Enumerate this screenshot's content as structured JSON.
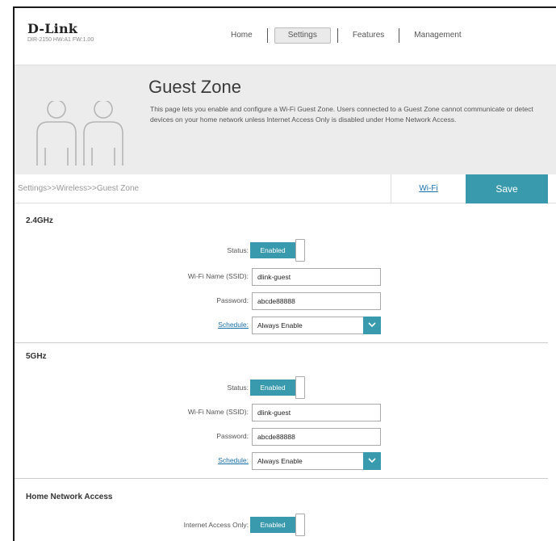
{
  "brand": {
    "logo": "D-Link",
    "model": "DIR-2150 HW:A1 FW:1.00"
  },
  "nav": {
    "home": "Home",
    "settings": "Settings",
    "features": "Features",
    "management": "Management"
  },
  "hero": {
    "title": "Guest Zone",
    "description": "This page lets you enable and configure a Wi-Fi Guest Zone. Users connected to a Guest Zone cannot communicate or detect devices on your home network unless Internet Access Only is disabled under Home Network Access.",
    "icon": "users-icon"
  },
  "breadcrumb": "Settings>>Wireless>>Guest Zone",
  "actions": {
    "wifi_link": "Wi-Fi",
    "save": "Save"
  },
  "band24": {
    "title": "2.4GHz",
    "status_label": "Status:",
    "status_value": "Enabled",
    "ssid_label": "Wi-Fi Name (SSID):",
    "ssid_value": "dlink-guest",
    "password_label": "Password:",
    "password_value": "abcde88888",
    "schedule_label": "Schedule:",
    "schedule_value": "Always Enable"
  },
  "band5": {
    "title": "5GHz",
    "status_label": "Status:",
    "status_value": "Enabled",
    "ssid_label": "Wi-Fi Name (SSID):",
    "ssid_value": "dlink-guest",
    "password_label": "Password:",
    "password_value": "abcde88888",
    "schedule_label": "Schedule:",
    "schedule_value": "Always Enable"
  },
  "home_network": {
    "title": "Home Network Access",
    "internet_only_label": "Internet Access Only:",
    "internet_only_value": "Enabled"
  },
  "colors": {
    "accent": "#3a9aad",
    "link": "#1a6fa8",
    "hero_bg": "#ececec"
  }
}
